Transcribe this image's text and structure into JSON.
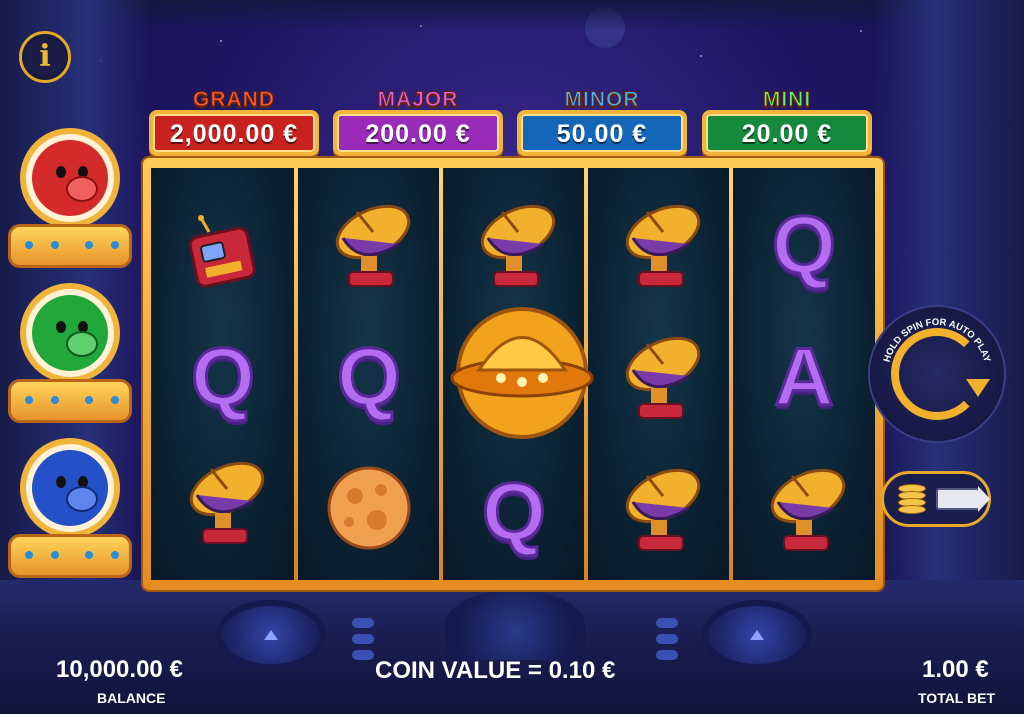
{
  "jackpots": [
    {
      "label": "GRAND",
      "value": "2,000.00 €",
      "label_color": "#ff5a3c",
      "plate_color": "#c8211f"
    },
    {
      "label": "MAJOR",
      "value": "200.00 €",
      "label_color": "#e25cf0",
      "plate_color": "#9a2ab8"
    },
    {
      "label": "MINOR",
      "value": "50.00 €",
      "label_color": "#3fb4ff",
      "plate_color": "#1466b8"
    },
    {
      "label": "MINI",
      "value": "20.00 €",
      "label_color": "#5ef07a",
      "plate_color": "#168a3c"
    }
  ],
  "reels": [
    [
      "radio-icon",
      "Q",
      "satellite-dish-icon"
    ],
    [
      "satellite-dish-icon",
      "Q",
      "moon-icon"
    ],
    [
      "satellite-dish-icon",
      "ufo-icon",
      "Q"
    ],
    [
      "satellite-dish-icon",
      "satellite-dish-icon",
      "satellite-dish-icon"
    ],
    [
      "Q",
      "A",
      "satellite-dish-icon"
    ]
  ],
  "pigs": [
    {
      "color": "red",
      "hex": "#d42a2a"
    },
    {
      "color": "green",
      "hex": "#22a83a"
    },
    {
      "color": "blue",
      "hex": "#2450c8"
    }
  ],
  "spin": {
    "hint": "HOLD SPIN FOR AUTO PLAY"
  },
  "footer": {
    "balance_value": "10,000.00 €",
    "balance_label": "BALANCE",
    "coin_value": "COIN VALUE = 0.10 €",
    "total_bet_value": "1.00 €",
    "total_bet_label": "TOTAL BET"
  },
  "info": {
    "label": "i"
  }
}
